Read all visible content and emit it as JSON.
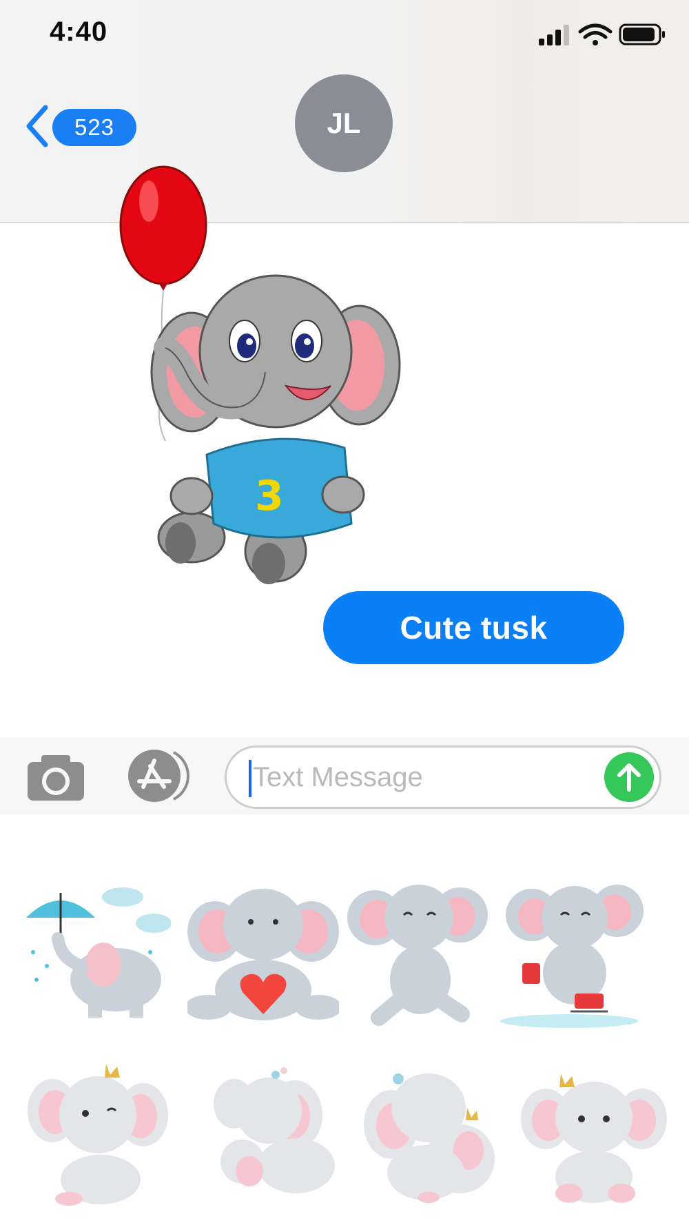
{
  "status_bar": {
    "time": "4:40",
    "icons": [
      "cellular-signal-icon",
      "wifi-icon",
      "battery-icon"
    ]
  },
  "header": {
    "back_count": "523",
    "contact_initials": "JL"
  },
  "conversation": {
    "sticker": "elephant-balloon-sticker",
    "message_text": "Cute tusk"
  },
  "input_bar": {
    "placeholder": "Text Message",
    "buttons": [
      "camera-icon",
      "app-store-icon",
      "send-arrow-icon"
    ]
  },
  "sticker_drawer": {
    "stickers": [
      "elephant-umbrella-sticker",
      "elephant-heart-sticker",
      "elephant-dancing-sticker",
      "elephant-skating-sticker",
      "elephant-crown-thinking-sticker",
      "elephant-mother-baby-sticker",
      "elephant-hugging-sticker",
      "elephant-crown-sitting-sticker"
    ]
  },
  "colors": {
    "accent_blue": "#0a7ff6",
    "send_green": "#35c759",
    "avatar_gray": "#8a8d96"
  }
}
